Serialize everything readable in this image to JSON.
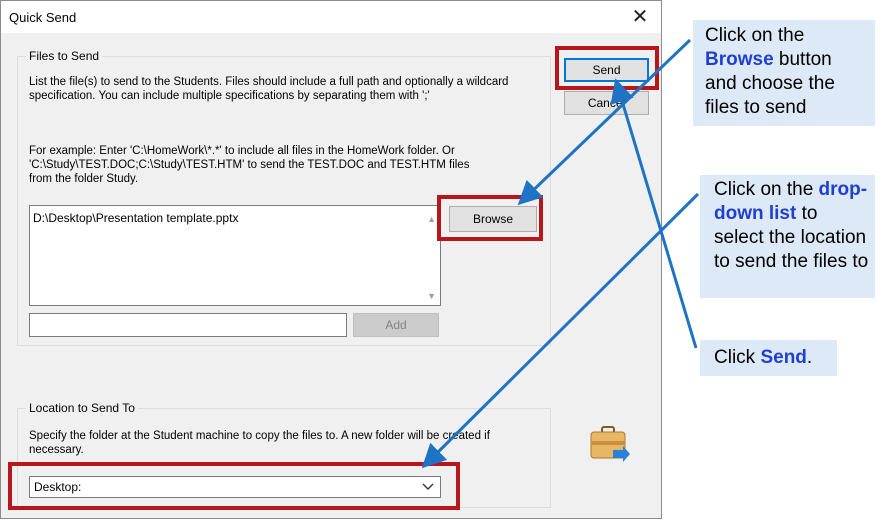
{
  "dialog": {
    "title": "Quick Send",
    "close_glyph": "✕",
    "files_group": {
      "legend": "Files to Send",
      "instructions": "List the file(s) to send to the Students. Files should include a full path and optionally a wildcard specification. You can include multiple specifications by separating them with ';'",
      "example": "For example: Enter 'C:\\HomeWork\\*.*' to include all files in the HomeWork folder. Or 'C:\\Study\\TEST.DOC;C:\\Study\\TEST.HTM' to send the TEST.DOC and TEST.HTM files from the folder Study.",
      "files_list": [
        "D:\\Desktop\\Presentation template.pptx"
      ],
      "scroll_up": "▲",
      "scroll_down": "▼",
      "browse_label": "Browse",
      "add_input_value": "",
      "add_label": "Add"
    },
    "send_label": "Send",
    "cancel_label": "Cancel",
    "location_group": {
      "legend": "Location to Send To",
      "instructions": "Specify the folder at the Student machine to copy the files to. A new folder will be created if necessary.",
      "selected": "Desktop:"
    },
    "icon": "briefcase-send-icon"
  },
  "callouts": [
    {
      "before": "Click on the ",
      "highlight": "Browse",
      "after": " button and choose the files to send"
    },
    {
      "before": "Click on the ",
      "highlight": "drop-down list",
      "after": " to select the location to send the files to"
    },
    {
      "before": "Click ",
      "highlight": "Send",
      "after": "."
    }
  ],
  "colors": {
    "highlight_box": "#b7161e",
    "arrow": "#1f73c4",
    "callout_bg": "#dde9f7",
    "callout_highlight": "#1f3fd1"
  }
}
